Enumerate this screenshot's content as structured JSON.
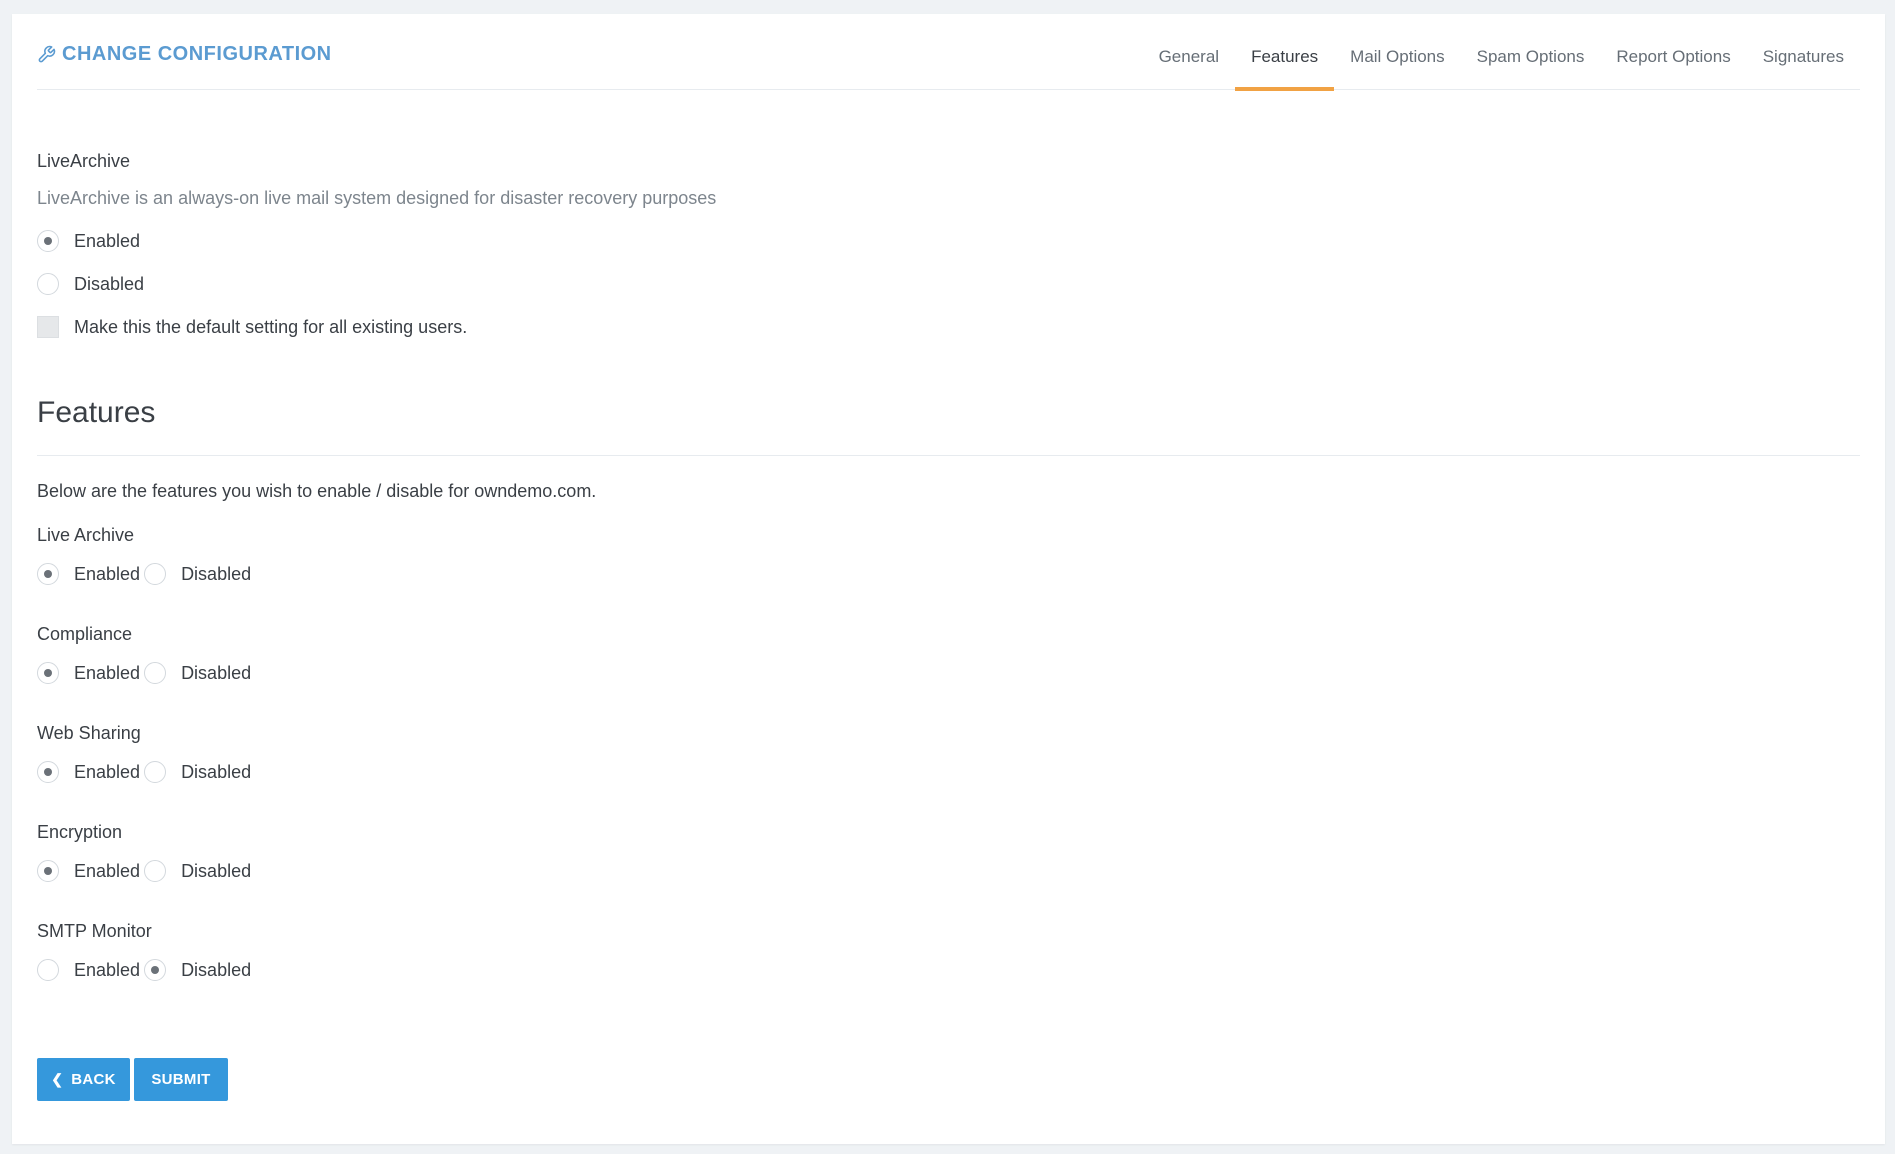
{
  "header": {
    "title": "CHANGE CONFIGURATION",
    "tabs": [
      {
        "label": "General"
      },
      {
        "label": "Features",
        "active": true
      },
      {
        "label": "Mail Options"
      },
      {
        "label": "Spam Options"
      },
      {
        "label": "Report Options"
      },
      {
        "label": "Signatures"
      }
    ]
  },
  "livearchive": {
    "label": "LiveArchive",
    "description": "LiveArchive is an always-on live mail system designed for disaster recovery purposes",
    "enabled_label": "Enabled",
    "disabled_label": "Disabled",
    "selected": "Enabled",
    "default_checkbox_label": "Make this the default setting for all existing users.",
    "default_checked": false
  },
  "features": {
    "heading": "Features",
    "intro": "Below are the features you wish to enable / disable for owndemo.com.",
    "enabled_label": "Enabled",
    "disabled_label": "Disabled",
    "items": [
      {
        "name": "Live Archive",
        "selected": "Enabled"
      },
      {
        "name": "Compliance",
        "selected": "Enabled"
      },
      {
        "name": "Web Sharing",
        "selected": "Enabled"
      },
      {
        "name": "Encryption",
        "selected": "Enabled"
      },
      {
        "name": "SMTP Monitor",
        "selected": "Disabled"
      }
    ]
  },
  "actions": {
    "back_label": "BACK",
    "submit_label": "SUBMIT"
  },
  "colors": {
    "accent_blue": "#3598dc",
    "title_blue": "#5b9bd1",
    "active_tab_underline": "#f1a244"
  },
  "icons": {
    "title": "wrench-icon",
    "back": "chevron-left-icon"
  }
}
